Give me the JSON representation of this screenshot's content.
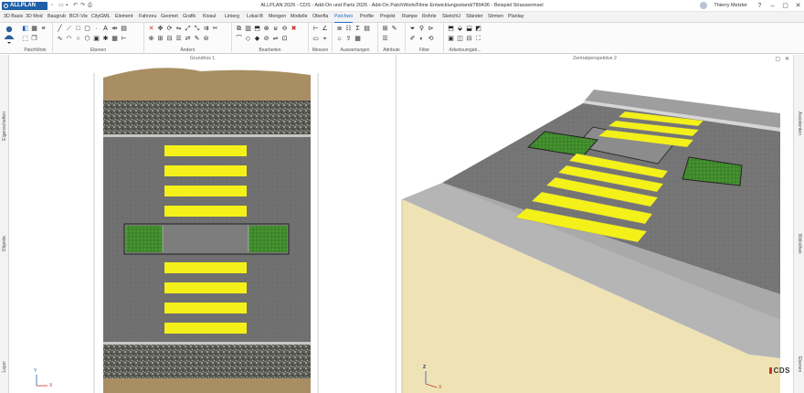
{
  "titlebar": {
    "app_name": "ALLPLAN 2026",
    "document_title": "ALLPLAN 2026 - CDS - Add-On und Parts 2026 - Add-On PatchWork/Filme Entwicklungsstand/789436 - Beispiel Strasseninsel",
    "user_name": "Thierry Metzler"
  },
  "tabs": [
    "3D Basis",
    "3D Mod",
    "Baugrub",
    "BCF-Vie",
    "CityGML",
    "Element",
    "Fahrzeu",
    "Geomet",
    "Grafik",
    "Kiosul",
    "Linierg",
    "Lokal-B",
    "Mengen",
    "Modelle",
    "Oberfla",
    "Patchwo",
    "Profile",
    "Projekt",
    "Rampe",
    "Rohrle",
    "SketchU",
    "Ständer",
    "Strmen",
    "Planlay"
  ],
  "active_tab": "Patchwo",
  "ribbon_groups": [
    {
      "label": "PatchWork"
    },
    {
      "label": "Ebenen"
    },
    {
      "label": "Ändern"
    },
    {
      "label": "Bearbeiten"
    },
    {
      "label": "Messen"
    },
    {
      "label": "Auswertungen"
    },
    {
      "label": "Attribute"
    },
    {
      "label": "Filter"
    },
    {
      "label": "Arbeitsumgeb..."
    }
  ],
  "left_panel_labels": [
    "Eigenschaften",
    "Objekte",
    "Layer"
  ],
  "right_panel_labels": [
    "Assistenten",
    "Bibliothek",
    "Ebenen"
  ],
  "views": {
    "left": {
      "title": "Grundriss 1",
      "axis_x": "X",
      "axis_y": "Y"
    },
    "right": {
      "title": "Zentralperspektive 2",
      "axis_z": "Z",
      "axis_x": "X"
    }
  },
  "watermark": "CDS",
  "colors": {
    "accent": "#1f6fc5",
    "badge": "#1f5fa8",
    "marking": "#f4f01a",
    "asphalt": "#6f6f6f",
    "grass": "#3e8a2a",
    "sand": "#efe3b6"
  }
}
